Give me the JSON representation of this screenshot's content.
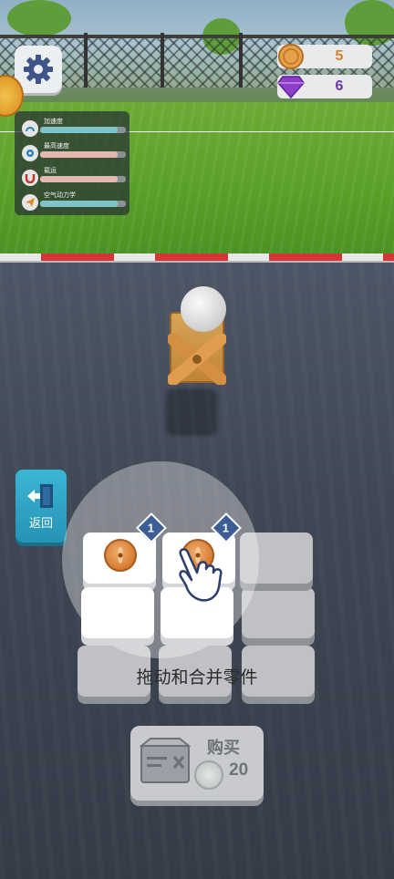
{
  "hud": {
    "coins": "5",
    "gems": "6",
    "coin_color": "#d2832a",
    "gem_color": "#6a35a8"
  },
  "stats": [
    {
      "label": "加速度",
      "icon": "speedometer-icon",
      "color": "#7fc4c9",
      "level": 0.9
    },
    {
      "label": "最高速度",
      "icon": "gear-icon",
      "color": "#e2b8b0",
      "level": 0.9
    },
    {
      "label": "载运",
      "icon": "magnet-icon",
      "color": "#e2b8b0",
      "level": 0.9
    },
    {
      "label": "空气动力学",
      "icon": "paper-plane-icon",
      "color": "#7fc4c9",
      "level": 0.9
    }
  ],
  "back_button": {
    "label": "返回"
  },
  "merge_grid": {
    "hint": "拖动和合并零件",
    "parts": [
      {
        "slot": "row1-col1",
        "level": "1"
      },
      {
        "slot": "row1-col2",
        "level": "1"
      }
    ]
  },
  "buy_button": {
    "label": "购买",
    "price": "20"
  }
}
